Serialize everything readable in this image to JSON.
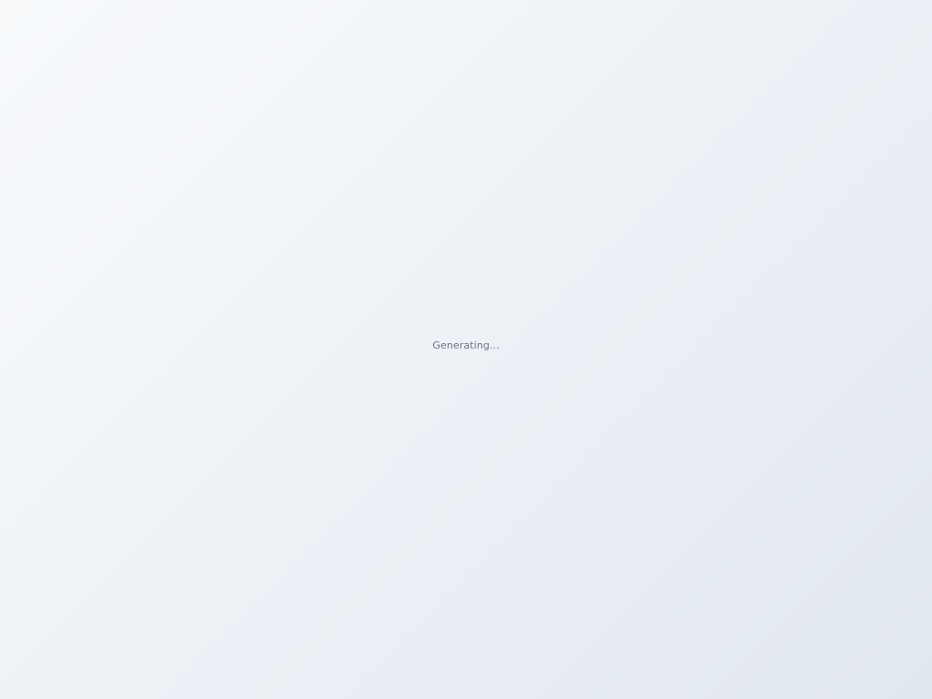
{
  "loading": {
    "status_text": "Generating..."
  },
  "colors": {
    "background_start": "#f8fafc",
    "background_end": "#e2e8f0",
    "status_text": "#6b7280"
  }
}
